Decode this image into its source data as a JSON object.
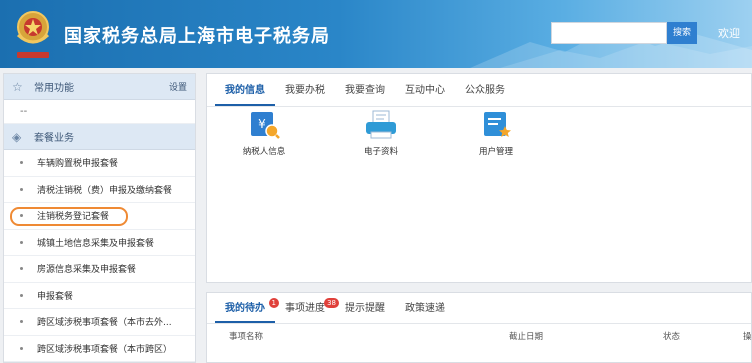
{
  "header": {
    "title": "国家税务总局上海市电子税务局",
    "search_placeholder": "",
    "search_button": "搜索",
    "welcome": "欢迎",
    "logo_icon": "tax-emblem-icon"
  },
  "sidebar": {
    "common": {
      "label": "常用功能",
      "settings": "设置",
      "blank": "--"
    },
    "package": {
      "label": "套餐业务",
      "items": [
        "车辆购置税申报套餐",
        "清税注销税（费）申报及缴纳套餐",
        "注销税务登记套餐",
        "城镇土地信息采集及申报套餐",
        "房源信息采集及申报套餐",
        "申报套餐",
        "跨区域涉税事项套餐（本市去外...",
        "跨区域涉税事项套餐（本市跨区）"
      ],
      "highlighted_index": 2
    }
  },
  "main": {
    "tabs": [
      "我的信息",
      "我要办税",
      "我要查询",
      "互动中心",
      "公众服务"
    ],
    "active_tab": 0,
    "tiles": [
      {
        "label": "纳税人信息",
        "icon": "taxpayer-info-icon"
      },
      {
        "label": "电子资料",
        "icon": "electronic-docs-icon"
      },
      {
        "label": "用户管理",
        "icon": "user-management-icon"
      }
    ]
  },
  "bottom": {
    "tabs": [
      {
        "label": "我的待办",
        "badge": "1"
      },
      {
        "label": "事项进度",
        "badge": "38"
      },
      {
        "label": "提示提醒",
        "badge": ""
      },
      {
        "label": "政策速递",
        "badge": ""
      }
    ],
    "columns": [
      "事项名称",
      "截止日期",
      "状态",
      "操"
    ]
  },
  "colors": {
    "accent": "#1d5fa8",
    "highlight": "#ef8a34",
    "badge": "#e0403a"
  }
}
